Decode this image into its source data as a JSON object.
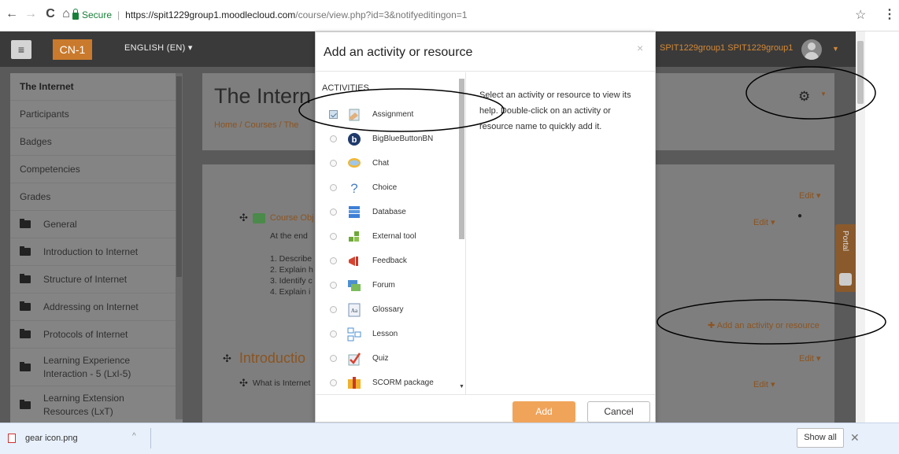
{
  "browser": {
    "secure_label": "Secure",
    "url_host": "https://spit1229group1.moodlecloud.com",
    "url_path": "/course/view.php?id=3&notifyeditingon=1"
  },
  "navbar": {
    "brand": "CN-1",
    "language": "ENGLISH (EN) ▾",
    "user": "SPIT1229group1 SPIT1229group1"
  },
  "sidebar": {
    "items": [
      {
        "label": "The Internet"
      },
      {
        "label": "Participants"
      },
      {
        "label": "Badges"
      },
      {
        "label": "Competencies"
      },
      {
        "label": "Grades"
      },
      {
        "label": "General"
      },
      {
        "label": "Introduction to Internet"
      },
      {
        "label": "Structure of Internet"
      },
      {
        "label": "Addressing on Internet"
      },
      {
        "label": "Protocols of Internet"
      },
      {
        "label": "Learning Experience Interaction - 5 (LxI-5)"
      },
      {
        "label": "Learning Extension Resources (LxT)"
      }
    ]
  },
  "course": {
    "title": "The Intern",
    "breadcrumb": "Home / Courses / The",
    "course_obj": "Course Obj",
    "at_end": "At the end",
    "list": [
      "1. Describe",
      "2. Explain h",
      "3. Identify c",
      "4. Explain i"
    ],
    "section_title": "Introductio",
    "what_is": "What is Internet",
    "edit": "Edit ▾",
    "add_activity": "✚  Add an activity or resource",
    "portal": "Portal"
  },
  "modal": {
    "title": "Add an activity or resource",
    "close": "×",
    "section_label": "ACTIVITIES",
    "help_text": "Select an activity or resource to view its help. Double-click on an activity or resource name to quickly add it.",
    "add_label": "Add",
    "cancel_label": "Cancel",
    "options": [
      {
        "name": "Assignment",
        "icon": "assignment-icon",
        "checked": true
      },
      {
        "name": "BigBlueButtonBN",
        "icon": "bigbluebutton-icon"
      },
      {
        "name": "Chat",
        "icon": "chat-icon"
      },
      {
        "name": "Choice",
        "icon": "choice-icon"
      },
      {
        "name": "Database",
        "icon": "database-icon"
      },
      {
        "name": "External tool",
        "icon": "external-tool-icon"
      },
      {
        "name": "Feedback",
        "icon": "feedback-icon"
      },
      {
        "name": "Forum",
        "icon": "forum-icon"
      },
      {
        "name": "Glossary",
        "icon": "glossary-icon"
      },
      {
        "name": "Lesson",
        "icon": "lesson-icon"
      },
      {
        "name": "Quiz",
        "icon": "quiz-icon"
      },
      {
        "name": "SCORM package",
        "icon": "scorm-icon"
      }
    ]
  },
  "downloads": {
    "file": "gear icon.png",
    "show_all": "Show all"
  }
}
